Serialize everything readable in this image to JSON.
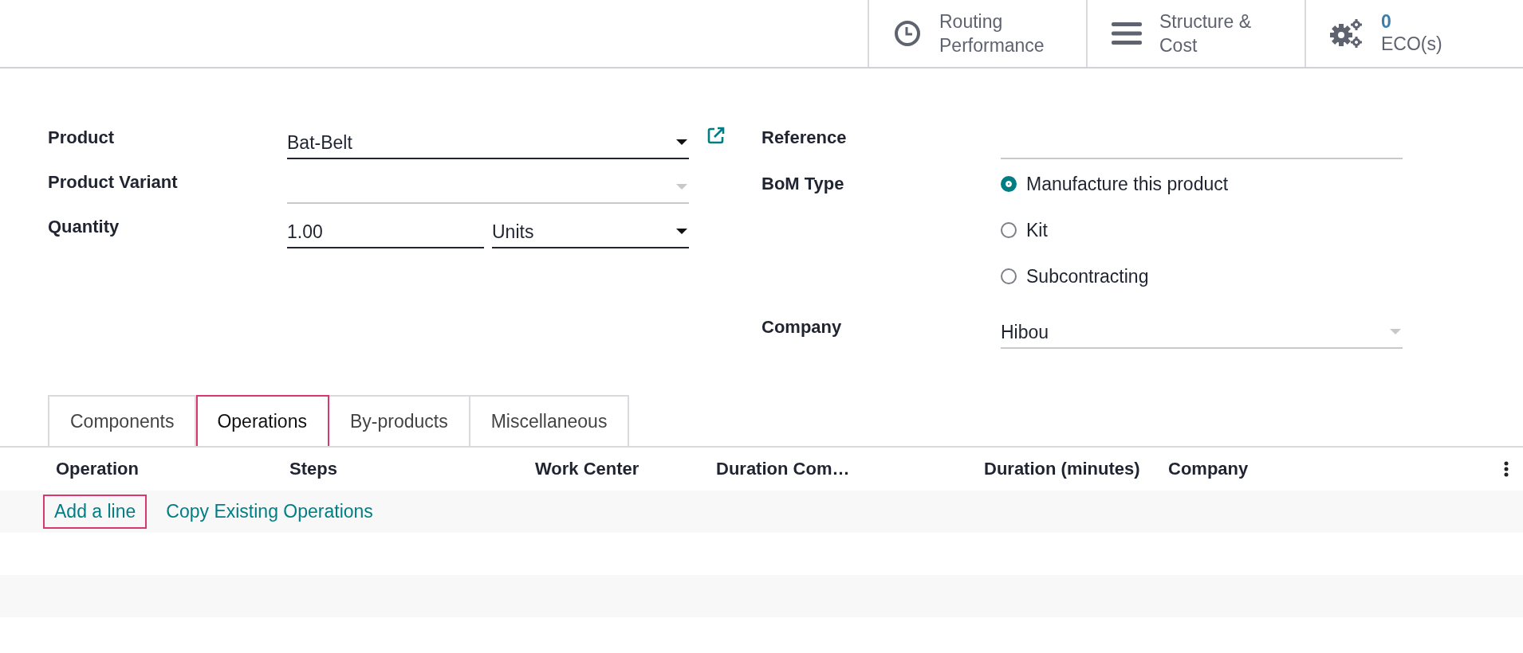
{
  "smart_buttons": [
    {
      "kind": "clock",
      "lines": [
        "Routing",
        "Performance"
      ]
    },
    {
      "kind": "bars",
      "lines": [
        "Structure &",
        "Cost"
      ]
    },
    {
      "kind": "gears",
      "lines": [
        "ECO(s)"
      ],
      "count": "0"
    }
  ],
  "form": {
    "left": [
      {
        "label": "Product",
        "kind": "many2one",
        "value": "Bat-Belt",
        "disabled": false,
        "external_link": true
      },
      {
        "label": "Product Variant",
        "kind": "many2one",
        "disabled": true,
        "external_link": false
      },
      {
        "label": "Quantity",
        "kind": "qty",
        "value": "1.00",
        "unit": "Units"
      }
    ],
    "right": [
      {
        "label": "Reference",
        "kind": "text"
      },
      {
        "label": "BoM Type",
        "kind": "radio",
        "options": [
          {
            "label": "Manufacture this product",
            "selected": true
          },
          {
            "label": "Kit",
            "selected": false
          },
          {
            "label": "Subcontracting",
            "selected": false
          }
        ]
      },
      {
        "label": "Company",
        "kind": "many2one",
        "value": "Hibou",
        "disabled": true
      }
    ]
  },
  "tabs": [
    {
      "label": "Components",
      "selected": false,
      "highlighted": false
    },
    {
      "label": "Operations",
      "selected": true,
      "highlighted": true
    },
    {
      "label": "By-products",
      "selected": false,
      "highlighted": false
    },
    {
      "label": "Miscellaneous",
      "selected": false,
      "highlighted": false
    }
  ],
  "table": {
    "columns": [
      "Operation",
      "Steps",
      "Work Center",
      "Duration Com…",
      "Duration (minutes)",
      "Company"
    ],
    "actions": [
      {
        "label": "Add a line",
        "highlighted": true
      },
      {
        "label": "Copy Existing Operations",
        "highlighted": false
      }
    ]
  }
}
